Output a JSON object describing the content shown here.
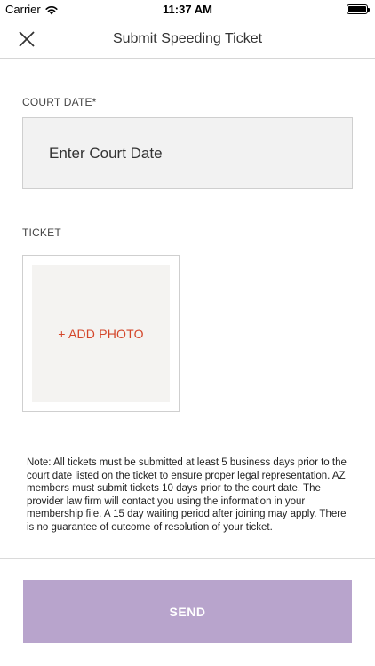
{
  "status_bar": {
    "carrier": "Carrier",
    "time": "11:37 AM"
  },
  "nav": {
    "title": "Submit Speeding Ticket"
  },
  "court_date": {
    "label": "COURT DATE*",
    "placeholder": "Enter Court Date",
    "value": ""
  },
  "ticket": {
    "label": "TICKET",
    "add_photo_label": "+ ADD PHOTO"
  },
  "note": "Note: All tickets must be submitted at least 5 business days prior to the court date listed on the ticket to ensure proper legal representation. AZ members must submit tickets 10 days prior to the court date. The provider law firm will contact you using the information in your membership file. A 15 day waiting period after joining may apply. There is no guarantee of outcome of resolution of your ticket.",
  "send_label": "SEND",
  "colors": {
    "accent": "#d4462a",
    "send_button": "#b8a4cc",
    "input_bg": "#f2f2f2",
    "photo_bg": "#f4f3f1"
  }
}
